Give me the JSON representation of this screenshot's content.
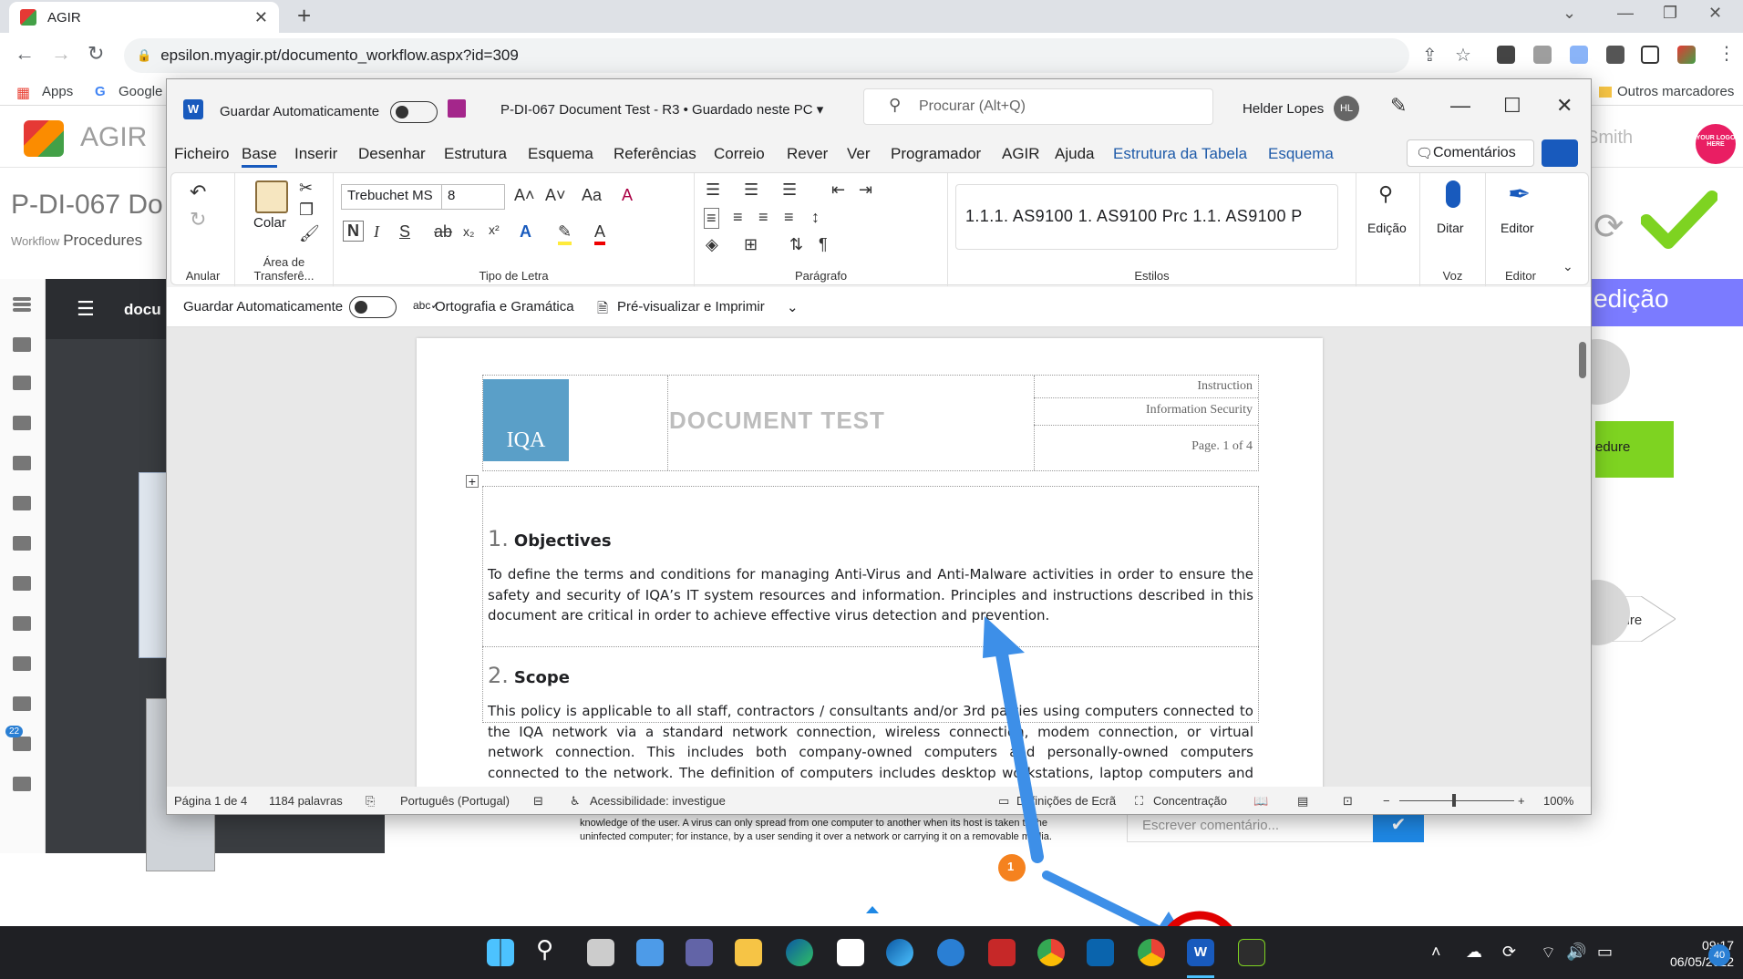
{
  "browser": {
    "tab_title": "AGIR",
    "url": "epsilon.myagir.pt/documento_workflow.aspx?id=309",
    "bookmarks": [
      "Apps",
      "Google"
    ],
    "other_bookmarks": "Outros marcadores"
  },
  "agir": {
    "app_name": "AGIR",
    "doc_title": "P-DI-067 Do",
    "workflow_label": "Workflow",
    "workflow_value": "Procedures",
    "panel_header": "docu",
    "user_partial": "Smith",
    "your_logo": "YOUR LOGO HERE",
    "edicao": "edição",
    "procedure_box": "edure",
    "procedure_shape": "rocedure",
    "below_text": "knowledge of the user. A virus can only spread from one computer to another when its host is taken to the uninfected computer; for instance, by a user sending it over a network or carrying it on a removable media.",
    "comment_placeholder": "Escrever comentário...",
    "badge_count": "22"
  },
  "word": {
    "autosave_label": "Guardar Automaticamente",
    "doc_name": "P-DI-067 Document Test - R3 • Guardado neste PC",
    "search_placeholder": "Procurar (Alt+Q)",
    "user_name": "Helder Lopes",
    "user_initials": "HL",
    "menu": [
      "Ficheiro",
      "Base",
      "Inserir",
      "Desenhar",
      "Estrutura",
      "Esquema",
      "Referências",
      "Correio",
      "Rever",
      "Ver",
      "Programador",
      "AGIR",
      "Ajuda"
    ],
    "menu_context": [
      "Estrutura da Tabela",
      "Esquema"
    ],
    "comments_label": "Comentários",
    "ribbon": {
      "undo_label": "Anular",
      "paste_label": "Colar",
      "clipboard_label": "Área de Transferê...",
      "font_name": "Trebuchet MS",
      "font_size": "8",
      "font_label": "Tipo de Letra",
      "paragraph_label": "Parágrafo",
      "styles": "1.1.1.  AS9100    1.  AS9100 Prc    1.1.  AS9100 P",
      "styles_label": "Estilos",
      "editing_label": "Edição",
      "dictate_label": "Ditar",
      "voice_label": "Voz",
      "editor_label": "Editor",
      "editor_group_label": "Editor"
    },
    "qat": {
      "autosave": "Guardar Automaticamente",
      "spelling": "Ortografia e Gramática",
      "preview": "Pré-visualizar e Imprimir"
    },
    "document": {
      "logo_text": "IQA",
      "title": "DOCUMENT TEST",
      "type": "Instruction",
      "category": "Information Security",
      "page_label": "Page",
      "page_of": "1 of 4",
      "section1_num": "1.",
      "section1_title": "Objectives",
      "section1_text": "To define the terms and conditions for managing Anti-Virus and Anti-Malware activities in order to ensure the safety and security of IQA’s IT system resources and information. Principles and instructions described in this document are critical in order to achieve effective virus detection and prevention.",
      "section2_num": "2.",
      "section2_title": "Scope",
      "section2_text": "This policy is applicable to all staff, contractors / consultants and/or 3rd parties using computers connected to the IQA network via a standard network connection, wireless connection, modem connection, or virtual network connection. This includes both company-owned computers and personally-owned computers connected to the network. The definition of computers includes desktop workstations, laptop computers and servers."
    },
    "status": {
      "page": "Página 1 de 4",
      "words": "1184 palavras",
      "language": "Português (Portugal)",
      "accessibility": "Acessibilidade: investigue",
      "display_settings": "Definições de Ecrã",
      "focus": "Concentração",
      "zoom": "100%"
    }
  },
  "annotation": {
    "step_number": "1"
  },
  "taskbar": {
    "time": "09:17",
    "date": "06/05/2022",
    "notifications": "40"
  },
  "colors": {
    "word_blue": "#185abd",
    "arrow_blue": "#3d8fe8",
    "highlight_red": "#e00000",
    "step_orange": "#f5821f",
    "agir_green": "#7ed321",
    "edicao_purple": "#7b7bff"
  }
}
